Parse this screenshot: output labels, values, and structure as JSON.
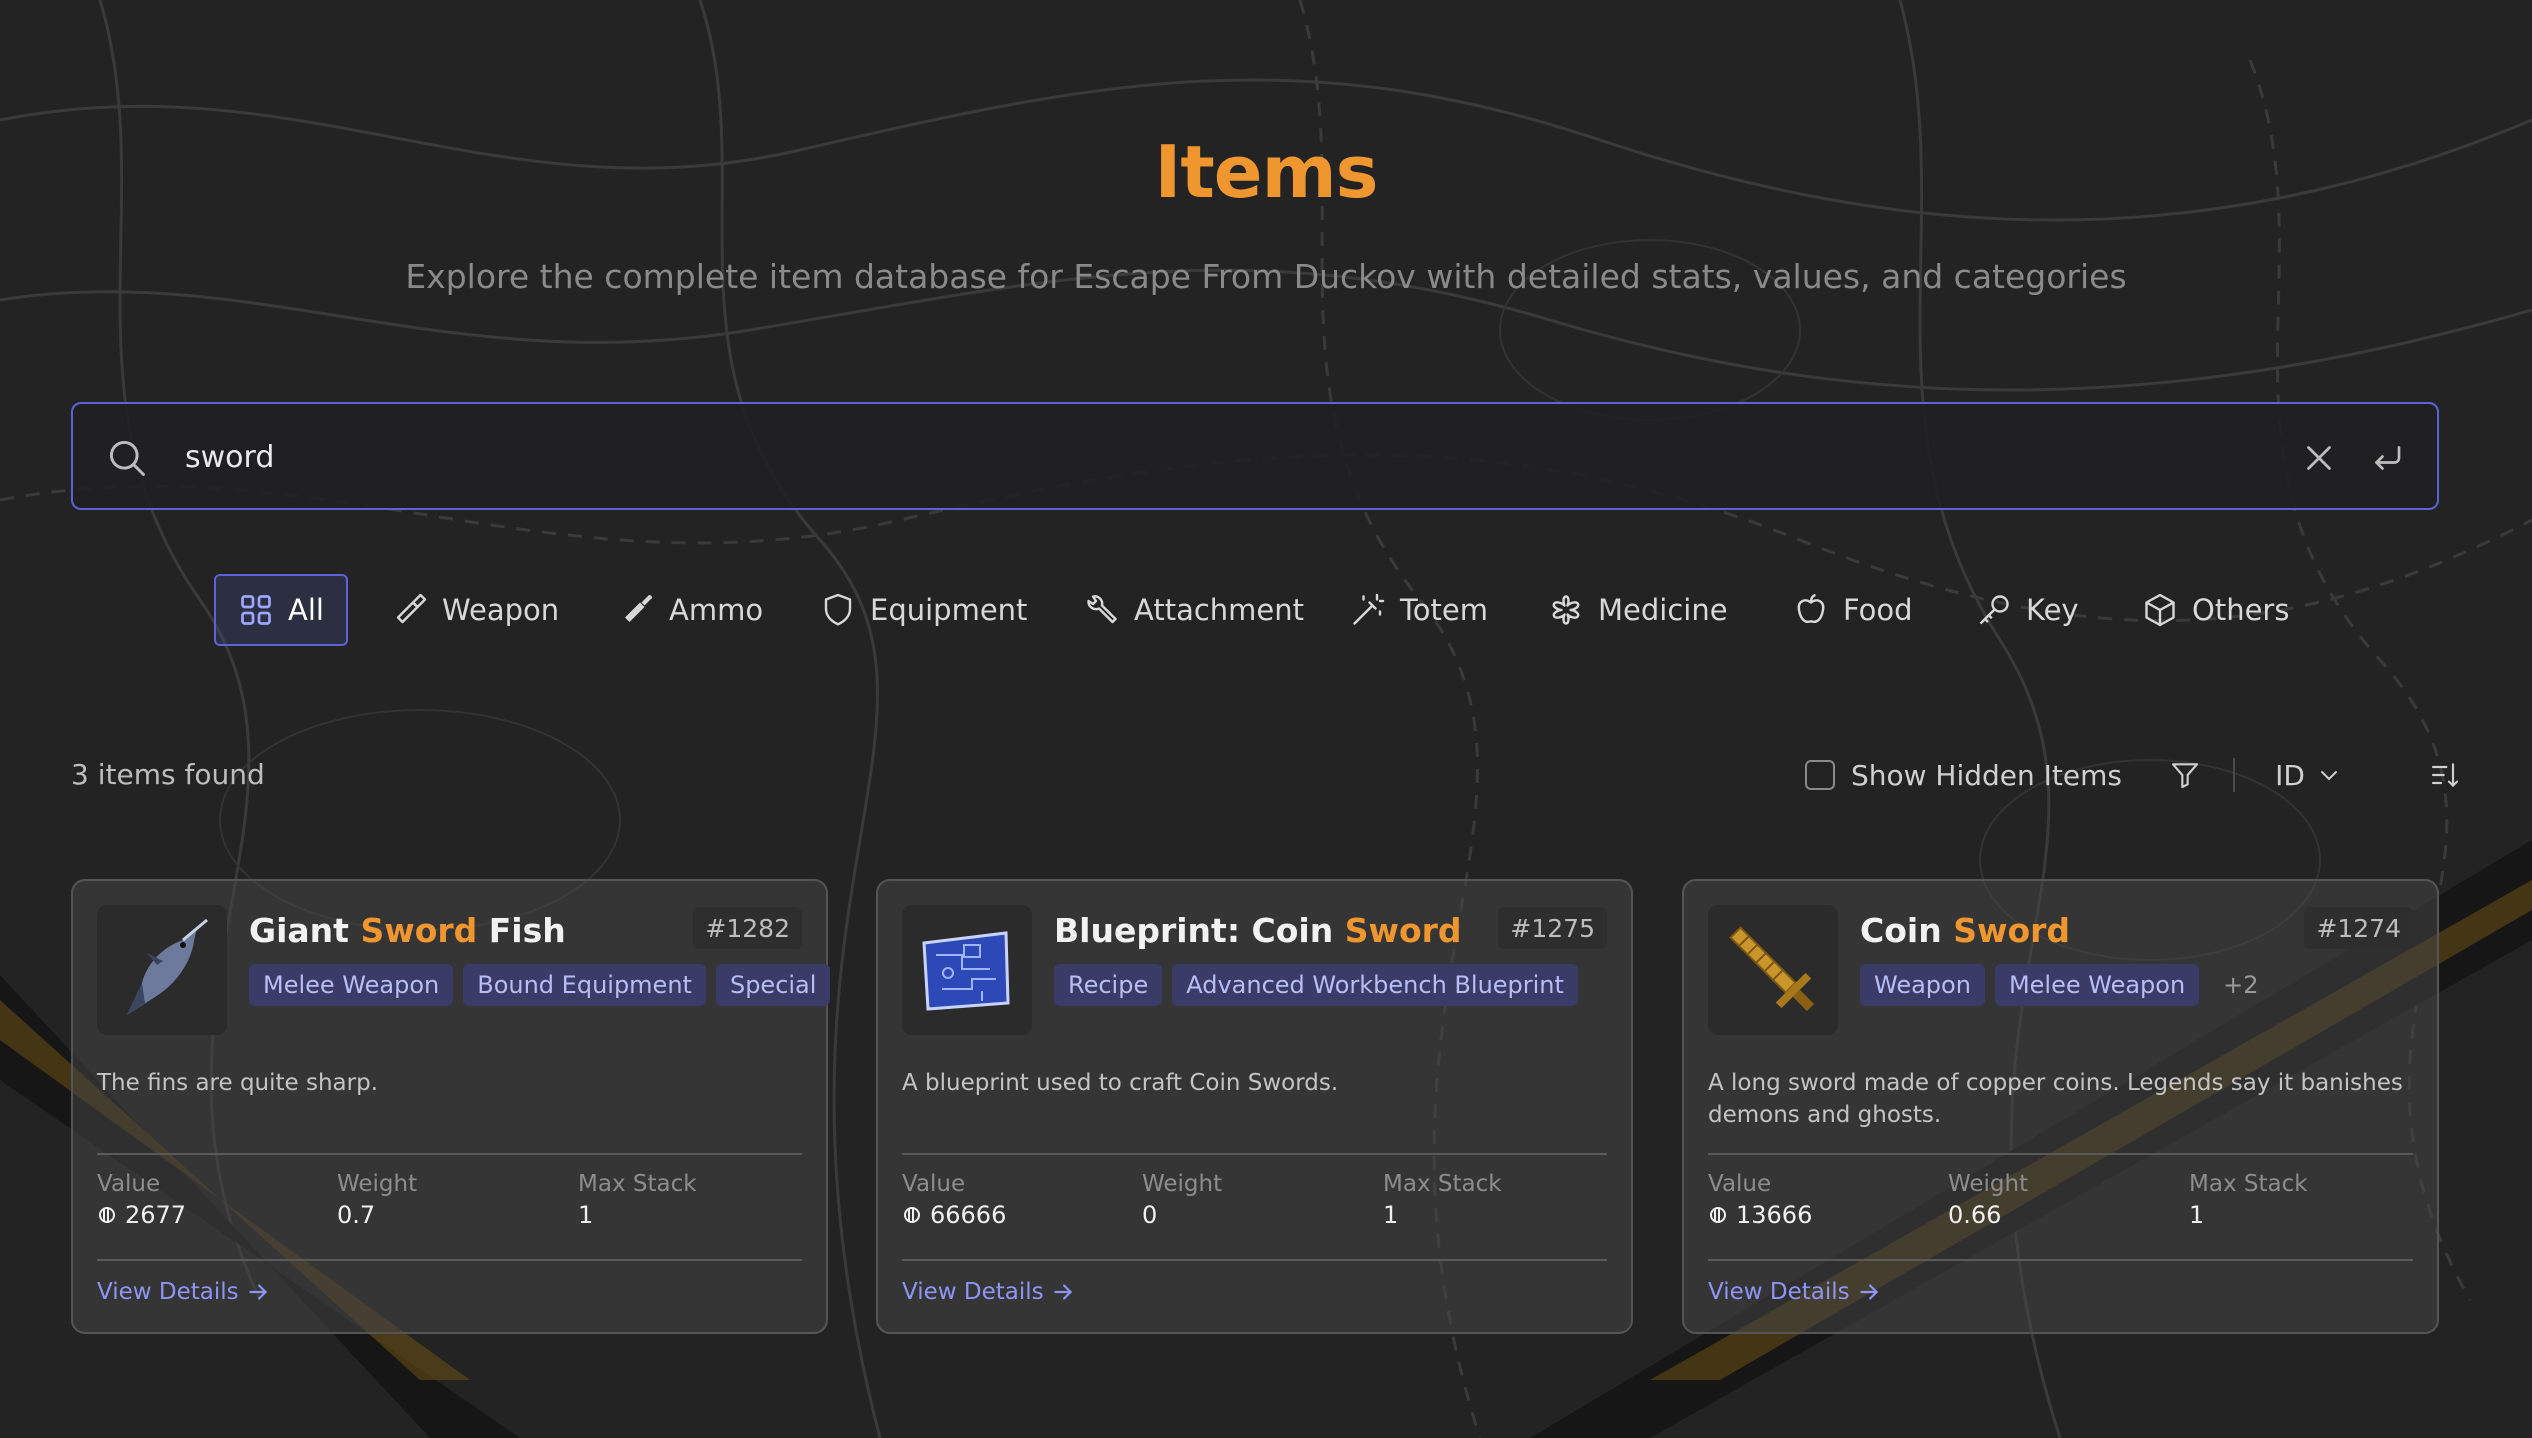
{
  "header": {
    "title": "Items",
    "subtitle": "Explore the complete item database for Escape From Duckov with detailed stats, values, and categories"
  },
  "search": {
    "value": "sword",
    "icon": "search-icon",
    "clear_icon": "close-icon",
    "submit_icon": "enter-icon"
  },
  "categories": [
    {
      "label": "All",
      "icon": "grid-icon",
      "active": true
    },
    {
      "label": "Weapon",
      "icon": "weapon-icon"
    },
    {
      "label": "Ammo",
      "icon": "bullet-icon"
    },
    {
      "label": "Equipment",
      "icon": "shield-icon"
    },
    {
      "label": "Attachment",
      "icon": "wrench-icon"
    },
    {
      "label": "Totem",
      "icon": "wand-icon"
    },
    {
      "label": "Medicine",
      "icon": "medicine-icon"
    },
    {
      "label": "Food",
      "icon": "apple-icon"
    },
    {
      "label": "Key",
      "icon": "key-icon"
    },
    {
      "label": "Others",
      "icon": "box-icon"
    }
  ],
  "results": {
    "count_text": "3 items found",
    "show_hidden_label": "Show Hidden Items",
    "show_hidden_checked": false,
    "sort_key": "ID"
  },
  "stat_labels": {
    "value": "Value",
    "weight": "Weight",
    "max_stack": "Max Stack"
  },
  "view_details_label": "View Details",
  "items": [
    {
      "name_before": "Giant ",
      "name_highlight": "Sword",
      "name_after": " Fish",
      "id": "#1282",
      "tags": [
        "Melee Weapon",
        "Bound Equipment",
        "Special"
      ],
      "description": "The fins are quite sharp.",
      "value": "2677",
      "weight": "0.7",
      "max_stack": "1",
      "thumb_icon": "swordfish-icon"
    },
    {
      "name_before": "Blueprint: Coin ",
      "name_highlight": "Sword",
      "name_after": "",
      "id": "#1275",
      "tags": [
        "Recipe",
        "Advanced Workbench Blueprint"
      ],
      "description": "A blueprint used to craft Coin Swords.",
      "value": "66666",
      "weight": "0",
      "max_stack": "1",
      "thumb_icon": "blueprint-icon"
    },
    {
      "name_before": "Coin ",
      "name_highlight": "Sword",
      "name_after": "",
      "id": "#1274",
      "tags": [
        "Weapon",
        "Melee Weapon",
        "+2"
      ],
      "description": "A long sword made of copper coins. Legends say it banishes demons and ghosts.",
      "value": "13666",
      "weight": "0.66",
      "max_stack": "1",
      "thumb_icon": "coin-sword-icon"
    }
  ],
  "colors": {
    "accent": "#f0962e",
    "primary": "#5b63d6",
    "tag_bg": "#3a3b66",
    "tag_text": "#b9bdf5",
    "link": "#8e95f5",
    "background": "#232323"
  }
}
